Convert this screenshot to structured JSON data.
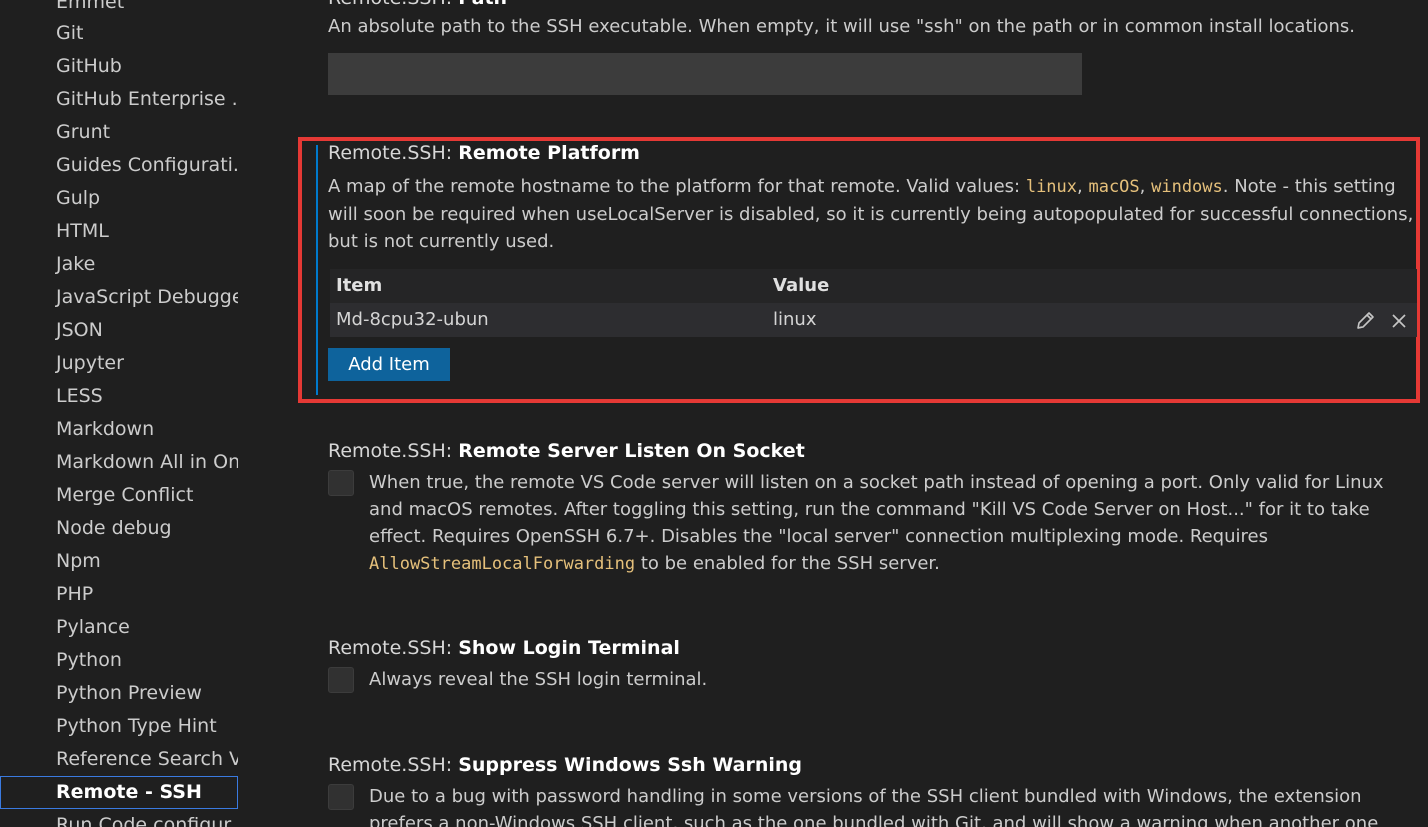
{
  "sidebar": {
    "items": [
      {
        "label": "Emmet"
      },
      {
        "label": "Git"
      },
      {
        "label": "GitHub"
      },
      {
        "label": "GitHub Enterprise ..."
      },
      {
        "label": "Grunt"
      },
      {
        "label": "Guides Configurati..."
      },
      {
        "label": "Gulp"
      },
      {
        "label": "HTML"
      },
      {
        "label": "Jake"
      },
      {
        "label": "JavaScript Debugger"
      },
      {
        "label": "JSON"
      },
      {
        "label": "Jupyter"
      },
      {
        "label": "LESS"
      },
      {
        "label": "Markdown"
      },
      {
        "label": "Markdown All in One"
      },
      {
        "label": "Merge Conflict"
      },
      {
        "label": "Node debug"
      },
      {
        "label": "Npm"
      },
      {
        "label": "PHP"
      },
      {
        "label": "Pylance"
      },
      {
        "label": "Python"
      },
      {
        "label": "Python Preview"
      },
      {
        "label": "Python Type Hint"
      },
      {
        "label": "Reference Search V..."
      },
      {
        "label": "Remote - SSH",
        "active": true
      },
      {
        "label": "Run Code configur..."
      }
    ]
  },
  "settings": {
    "path": {
      "category": "Remote.SSH: ",
      "name": "Path",
      "description": "An absolute path to the SSH executable. When empty, it will use \"ssh\" on the path or in common install locations.",
      "value": ""
    },
    "remote_platform": {
      "category": "Remote.SSH: ",
      "name": "Remote Platform",
      "desc_part1": "A map of the remote hostname to the platform for that remote. Valid values: ",
      "code1": "linux",
      "sep1": ", ",
      "code2": "macOS",
      "sep2": ", ",
      "code3": "windows",
      "desc_part2": ". Note - this setting will soon be required when useLocalServer is disabled, so it is currently being autopopulated for successful connections, but is not currently used.",
      "table": {
        "col_item": "Item",
        "col_value": "Value",
        "rows": [
          {
            "item": "Md-8cpu32-ubun",
            "value": "linux"
          }
        ]
      },
      "add_item_label": "Add Item"
    },
    "listen_on_socket": {
      "category": "Remote.SSH: ",
      "name": "Remote Server Listen On Socket",
      "checked": false,
      "desc_part1": "When true, the remote VS Code server will listen on a socket path instead of opening a port. Only valid for Linux and macOS remotes. After toggling this setting, run the command \"Kill VS Code Server on Host...\" for it to take effect. Requires OpenSSH 6.7+. Disables the \"local server\" connection multiplexing mode. Requires ",
      "code": "AllowStreamLocalForwarding",
      "desc_part2": " to be enabled for the SSH server."
    },
    "show_login_terminal": {
      "category": "Remote.SSH: ",
      "name": "Show Login Terminal",
      "checked": false,
      "description": "Always reveal the SSH login terminal."
    },
    "suppress_warning": {
      "category": "Remote.SSH: ",
      "name": "Suppress Windows Ssh Warning",
      "checked": false,
      "description": "Due to a bug with password handling in some versions of the SSH client bundled with Windows, the extension prefers a non-Windows SSH client, such as the one bundled with Git, and will show a warning when another one can't be found."
    }
  },
  "colors": {
    "highlight_border": "#e53935",
    "accent": "#007acc",
    "button": "#0e639c",
    "code": "#e5c07b"
  }
}
